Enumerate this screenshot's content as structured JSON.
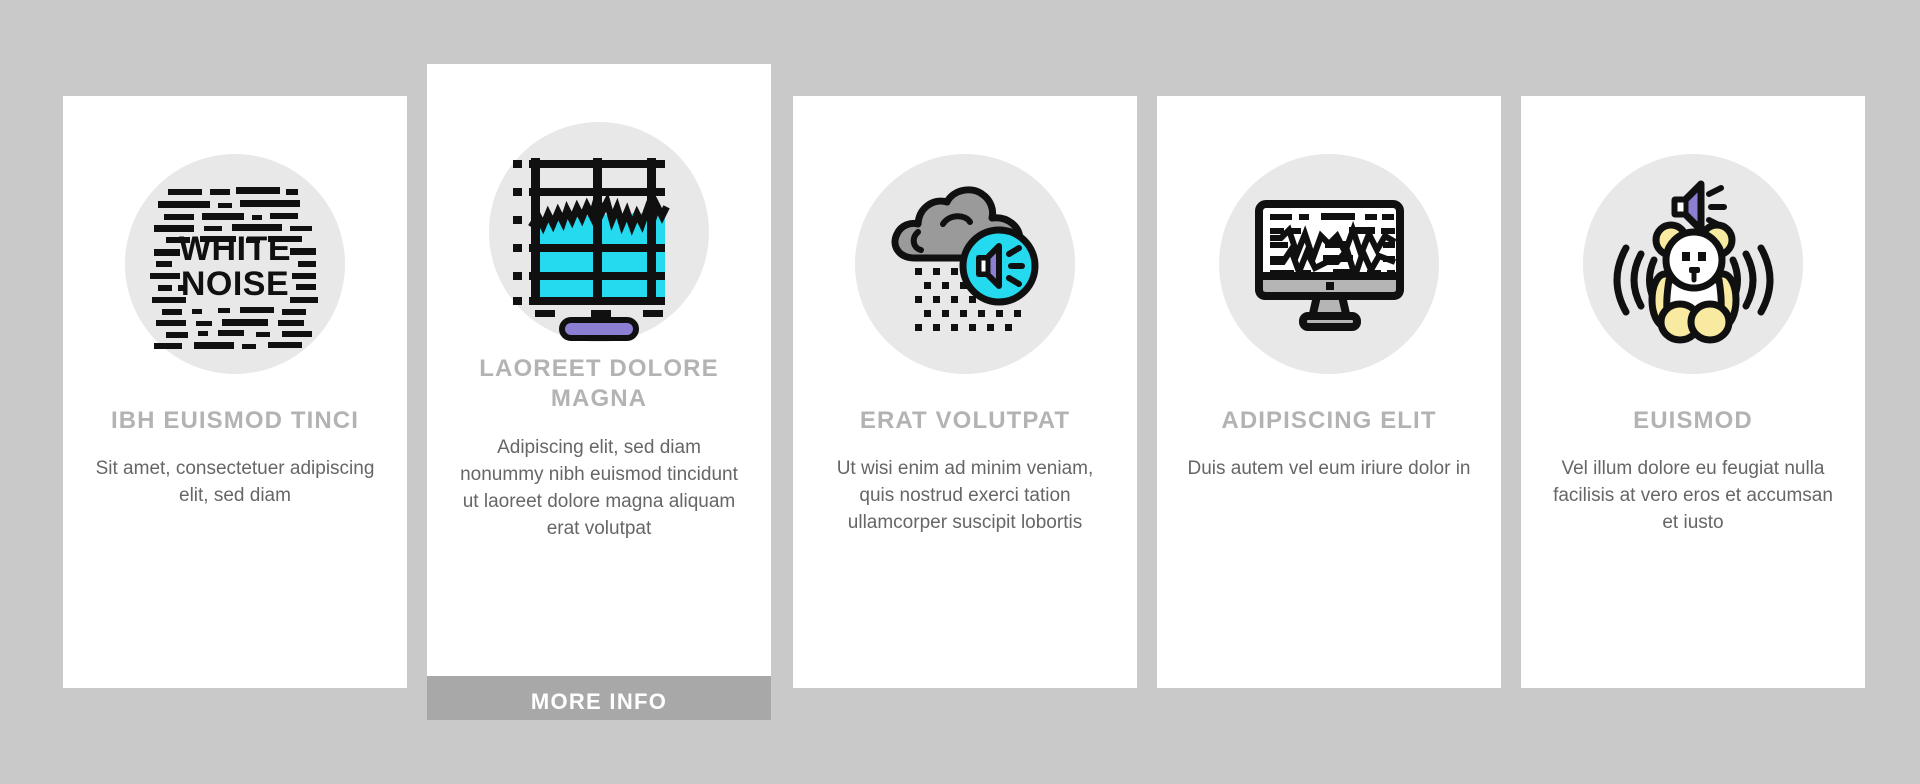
{
  "background_color": "#c9c9c9",
  "palette": {
    "card_bg": "#ffffff",
    "icon_disc": "#e8e8e8",
    "title_gray": "#b3b3b3",
    "body_gray": "#666666",
    "dot_inactive": "#e0e0e0",
    "dot_active": "#b0b0b0",
    "button_bg": "#a8a8a8",
    "button_text": "#ffffff",
    "accent_cyan": "#25d9ee",
    "accent_purple": "#8b7fd4",
    "accent_yellow": "#f8eaa0",
    "outline_black": "#101010",
    "cloud_gray": "#9a9a9a"
  },
  "cards": [
    {
      "icon": "white-noise-static-icon",
      "icon_label": "WHITE NOISE",
      "icon_line1": "WHITE",
      "icon_line2": "NOISE",
      "title": "IBH EUISMOD TINCI",
      "body": "Sit amet, consectetuer adipiscing elit, sed diam",
      "dots_total": 5,
      "dots_active_index": 0,
      "featured": false,
      "has_button": false
    },
    {
      "icon": "audio-waveform-chart-icon",
      "title": "LAOREET DOLORE MAGNA",
      "body": "Adipiscing elit, sed diam nonummy nibh euismod tincidunt ut laoreet dolore magna aliquam erat volutpat",
      "dots_total": 5,
      "dots_active_index": 1,
      "featured": true,
      "has_button": true,
      "button_label": "MORE INFO"
    },
    {
      "icon": "rain-cloud-speaker-icon",
      "title": "ERAT VOLUTPAT",
      "body": "Ut wisi enim ad minim veniam, quis nostrud exerci tation ullamcorper suscipit lobortis",
      "dots_total": 5,
      "dots_active_index": 2,
      "featured": false,
      "has_button": false
    },
    {
      "icon": "monitor-waveform-icon",
      "title": "ADIPISCING ELIT",
      "body": "Duis autem vel eum iriure dolor in",
      "dots_total": 5,
      "dots_active_index": 3,
      "featured": false,
      "has_button": false
    },
    {
      "icon": "teddy-bear-speaker-icon",
      "title": "EUISMOD",
      "body": "Vel illum dolore eu feugiat nulla facilisis at vero eros et accumsan et iusto",
      "dots_total": 5,
      "dots_active_index": 4,
      "featured": false,
      "has_button": false
    }
  ]
}
